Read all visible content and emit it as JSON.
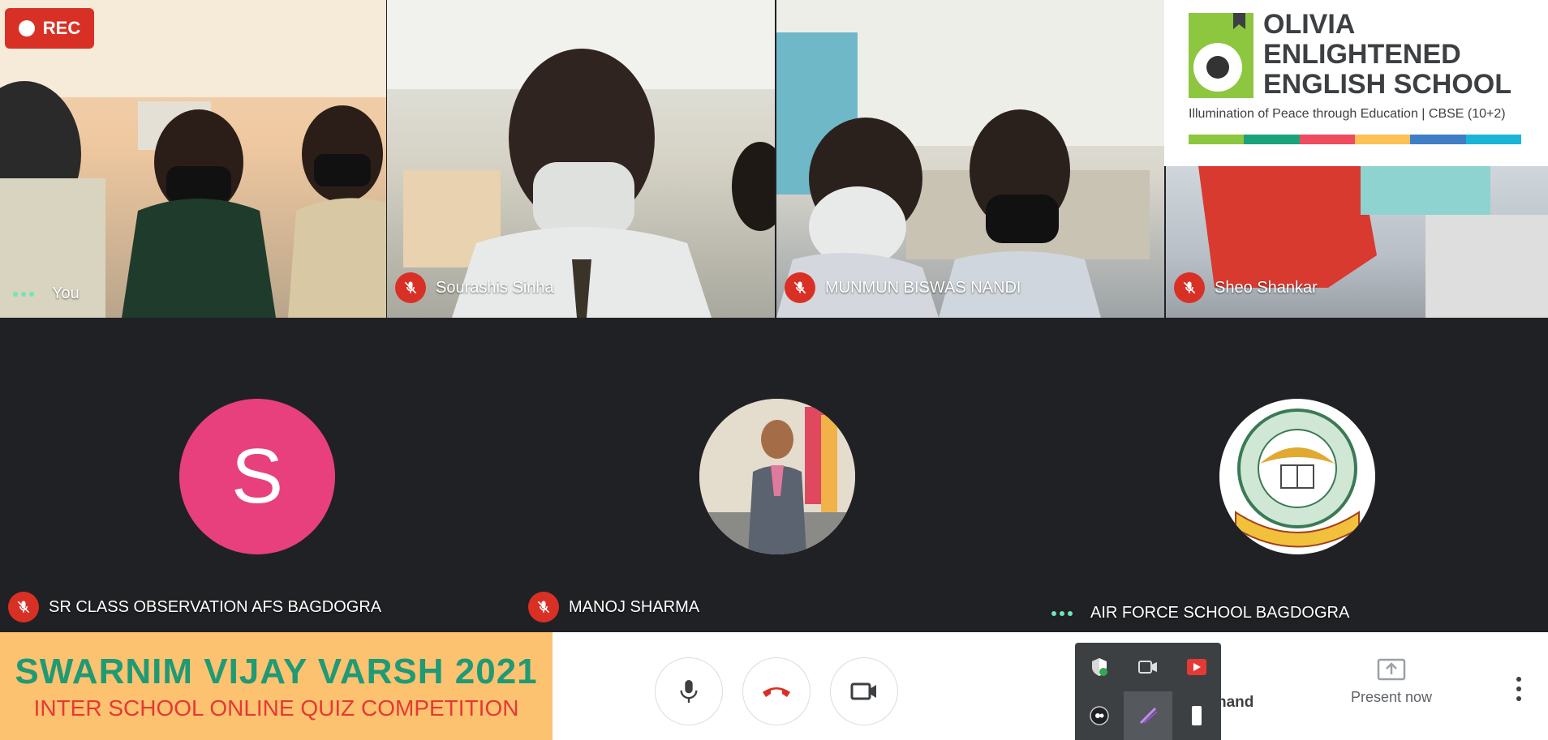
{
  "rec_label": "REC",
  "participants_top": [
    {
      "name": "You",
      "status": "speaking"
    },
    {
      "name": "Sourashis Sinha",
      "status": "muted"
    },
    {
      "name": "MUNMUN BISWAS NANDI",
      "status": "muted"
    },
    {
      "name": "Sheo Shankar",
      "status": "muted"
    }
  ],
  "participants_bottom": [
    {
      "name": "SR CLASS OBSERVATION AFS BAGDOGRA",
      "status": "muted",
      "avatar_letter": "S",
      "avatar_color": "#e8407c"
    },
    {
      "name": "MANOJ SHARMA",
      "status": "muted"
    },
    {
      "name": "AIR FORCE SCHOOL BAGDOGRA",
      "status": "speaking"
    }
  ],
  "logo": {
    "line1": "OLIVIA",
    "line2": "ENLIGHTENED",
    "line3": "ENGLISH SCHOOL",
    "tagline": "Illumination of Peace through Education | CBSE (10+2)",
    "stripe_colors": [
      "#8dc63f",
      "#1aa37a",
      "#ef4a5e",
      "#fbc155",
      "#3f7ec6",
      "#19b5d8"
    ]
  },
  "banner": {
    "title": "SWARNIM VIJAY VARSH 2021",
    "subtitle": "INTER SCHOOL ONLINE QUIZ COMPETITION"
  },
  "controls": {
    "raise_hand_label": "hand",
    "present_now_label": "Present now"
  },
  "colors": {
    "danger": "#d93025",
    "background": "#202124",
    "speaking": "#6ee7b7"
  }
}
